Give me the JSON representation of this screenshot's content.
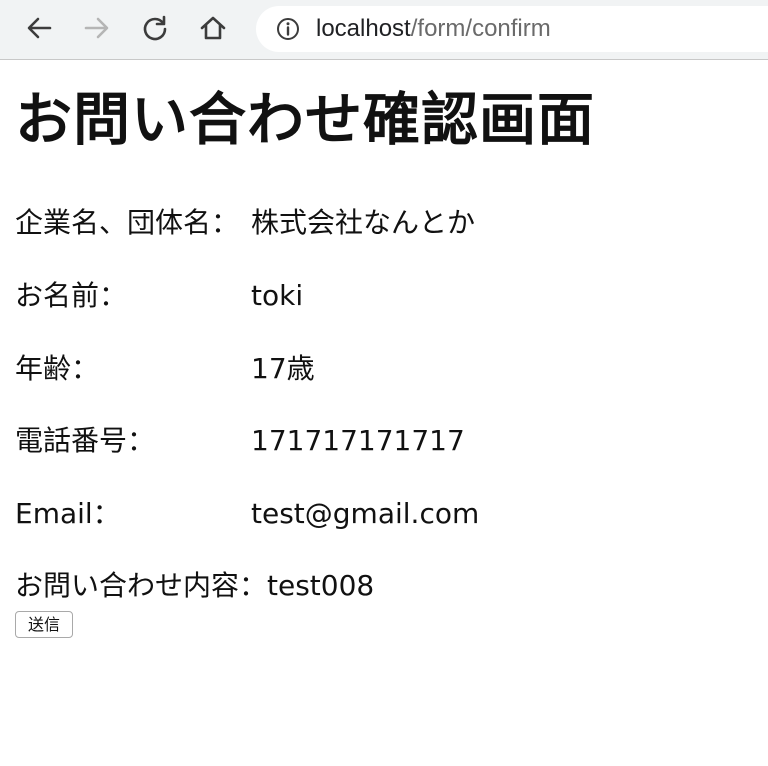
{
  "browser": {
    "url_host": "localhost",
    "url_path": "/form/confirm"
  },
  "page": {
    "title": "お問い合わせ確認画面"
  },
  "form": {
    "company_label": "企業名、団体名：",
    "company_value": "株式会社なんとか",
    "name_label": "お名前：",
    "name_value": "toki",
    "age_label": "年齢：",
    "age_value": "17歳",
    "phone_label": "電話番号：",
    "phone_value": "171717171717",
    "email_label": "Email：",
    "email_value": "test@gmail.com",
    "inquiry_label": "お問い合わせ内容：",
    "inquiry_value": "test008",
    "submit_label": "送信"
  },
  "colors": {
    "toolbar_bg": "#f1f3f4",
    "url_path": "#6a6a6a",
    "text": "#111111"
  },
  "icons": {
    "back": "arrow-left-icon",
    "forward": "arrow-right-icon",
    "reload": "reload-icon",
    "home": "home-icon",
    "site_info": "info-icon"
  }
}
